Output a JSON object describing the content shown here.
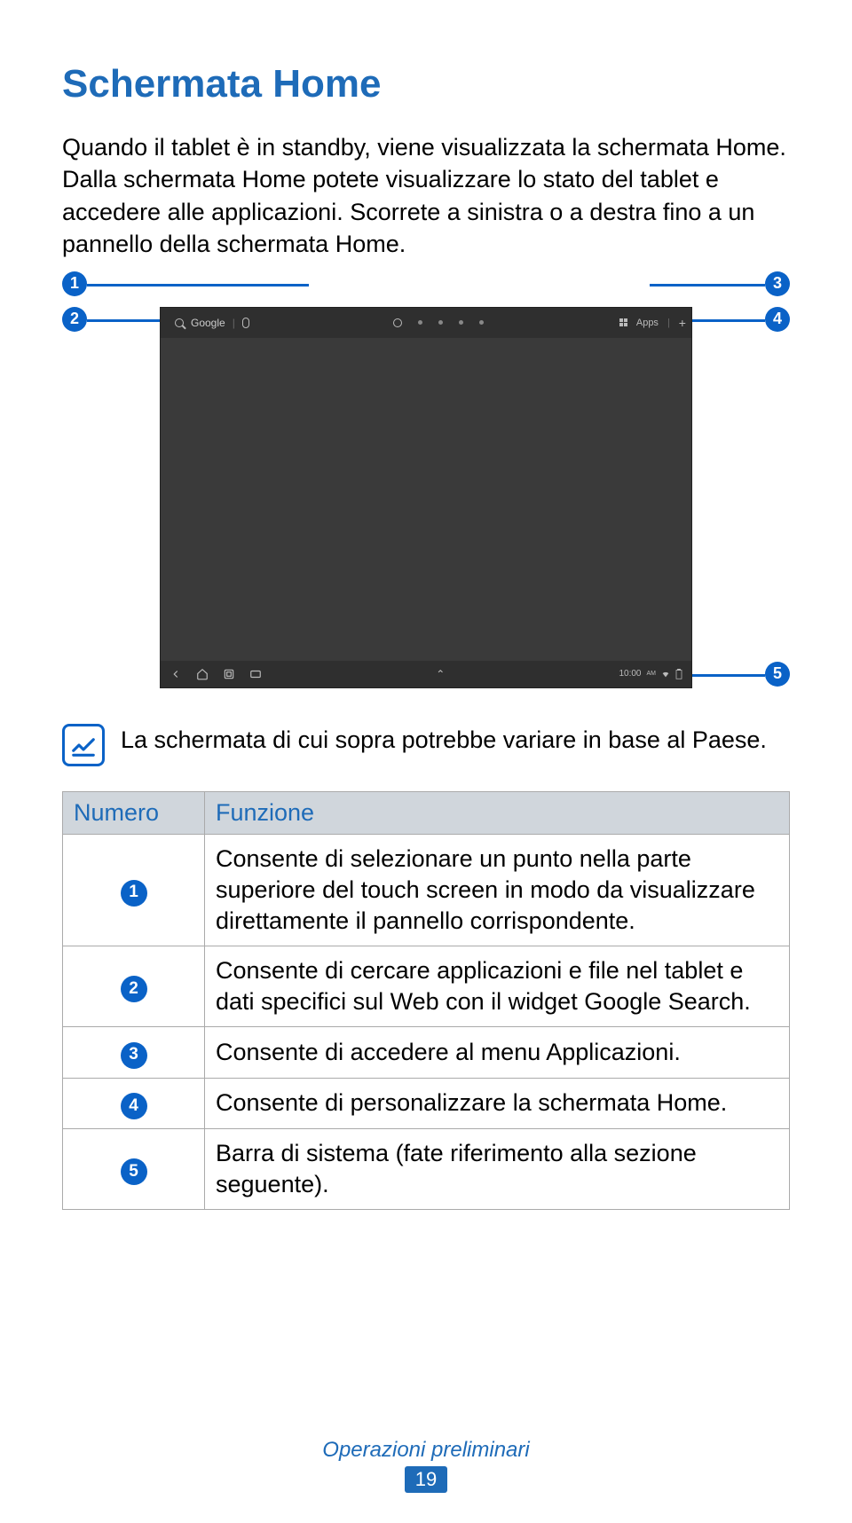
{
  "title": "Schermata Home",
  "paragraph": "Quando il tablet è in standby, viene visualizzata la schermata Home. Dalla schermata Home potete visualizzare lo stato del tablet e accedere alle applicazioni. Scorrete a sinistra o a destra fino a un pannello della schermata Home.",
  "screenshot": {
    "search_label": "Google",
    "apps_label": "Apps",
    "time": "10:00",
    "ampm": "AM"
  },
  "callouts": {
    "1": "1",
    "2": "2",
    "3": "3",
    "4": "4",
    "5": "5"
  },
  "note_text": "La schermata di cui sopra potrebbe variare in base al Paese.",
  "table": {
    "headers": {
      "numero": "Numero",
      "funzione": "Funzione"
    },
    "rows": [
      {
        "num": "1",
        "func": "Consente di selezionare un punto nella parte superiore del touch screen in modo da visualizzare direttamente il pannello corrispondente."
      },
      {
        "num": "2",
        "func": "Consente di cercare applicazioni e file nel tablet e dati specifici sul Web con il widget Google Search."
      },
      {
        "num": "3",
        "func": "Consente di accedere al menu Applicazioni."
      },
      {
        "num": "4",
        "func": "Consente di personalizzare la schermata Home."
      },
      {
        "num": "5",
        "func": "Barra di sistema (fate riferimento alla sezione seguente)."
      }
    ]
  },
  "footer": {
    "section": "Operazioni preliminari",
    "page": "19"
  }
}
